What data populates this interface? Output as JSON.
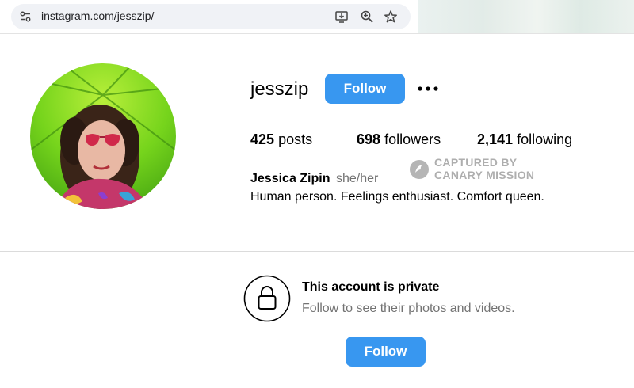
{
  "browser": {
    "url": "instagram.com/jesszip/",
    "icons": [
      "tune-icon",
      "install-app-icon",
      "zoom-icon",
      "bookmark-star-icon"
    ]
  },
  "profile": {
    "username": "jesszip",
    "follow_label": "Follow",
    "more_icon": "more-options-icon",
    "posts_count": "425",
    "posts_label": "posts",
    "followers_count": "698",
    "followers_label": "followers",
    "following_count": "2,141",
    "following_label": "following",
    "full_name": "Jessica Zipin",
    "pronouns": "she/her",
    "bio": "Human person. Feelings enthusiast. Comfort queen."
  },
  "watermark": {
    "line1": "CAPTURED BY",
    "line2": "CANARY MISSION"
  },
  "private": {
    "icon": "lock-icon",
    "title": "This account is private",
    "subtitle": "Follow to see their photos and videos.",
    "follow_label": "Follow"
  },
  "colors": {
    "follow_button": "#3897f0",
    "secondary_text": "#737373",
    "omnibox": "#f0f2f6"
  }
}
